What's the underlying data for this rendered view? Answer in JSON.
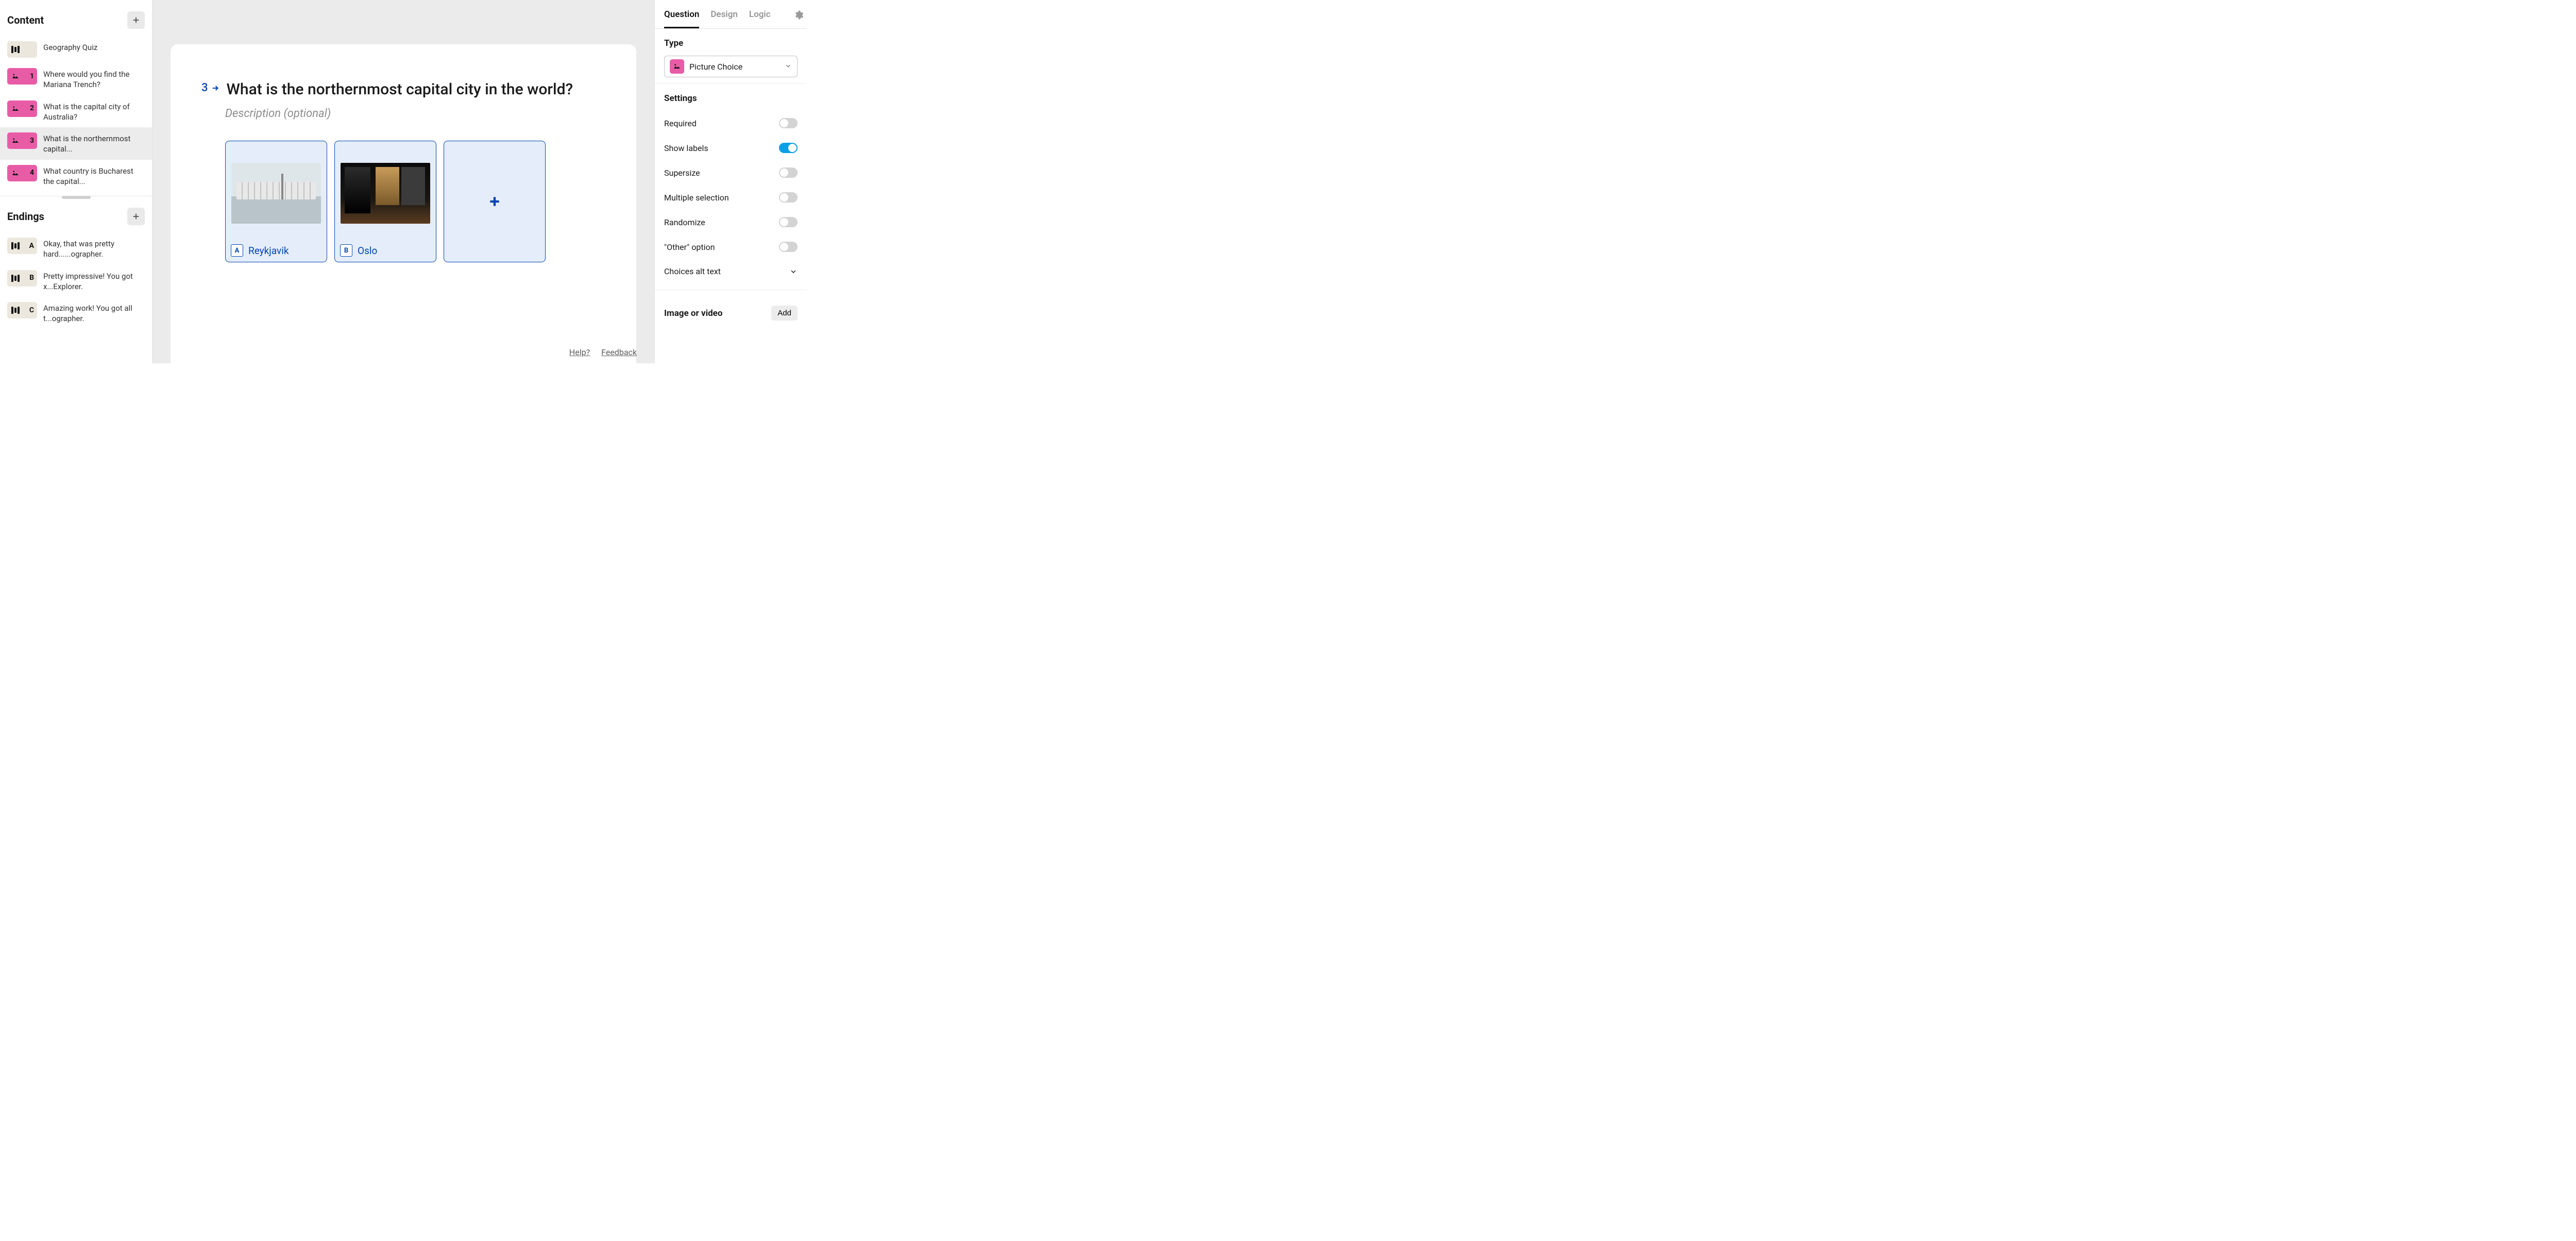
{
  "sidebar": {
    "content_header": "Content",
    "endings_header": "Endings",
    "intro_label": "Geography Quiz",
    "questions": [
      {
        "num": "1",
        "label": "Where would you find the Mariana Trench?"
      },
      {
        "num": "2",
        "label": "What is the capital city of Australia?"
      },
      {
        "num": "3",
        "label": "What is the northernmost capital..."
      },
      {
        "num": "4",
        "label": "What country is Bucharest the capital..."
      }
    ],
    "endings": [
      {
        "key": "A",
        "label": "Okay, that was pretty hard......ographer."
      },
      {
        "key": "B",
        "label": "Pretty impressive! You got x...Explorer."
      },
      {
        "key": "C",
        "label": "Amazing work! You got all t...ographer."
      }
    ]
  },
  "editor": {
    "num": "3",
    "title": "What is the northernmost capital city in the world?",
    "desc_placeholder": "Description (optional)",
    "choices": [
      {
        "key": "A",
        "label": "Reykjavik"
      },
      {
        "key": "B",
        "label": "Oslo"
      }
    ],
    "help_label": "Help?",
    "feedback_label": "Feedback"
  },
  "panel": {
    "tabs": {
      "question": "Question",
      "design": "Design",
      "logic": "Logic"
    },
    "type_label": "Type",
    "type_value": "Picture Choice",
    "settings_label": "Settings",
    "settings": {
      "required": "Required",
      "show_labels": "Show labels",
      "supersize": "Supersize",
      "multiple": "Multiple selection",
      "randomize": "Randomize",
      "other": "\"Other\" option",
      "alt_text": "Choices alt text"
    },
    "imgvid_label": "Image or video",
    "add_label": "Add"
  }
}
